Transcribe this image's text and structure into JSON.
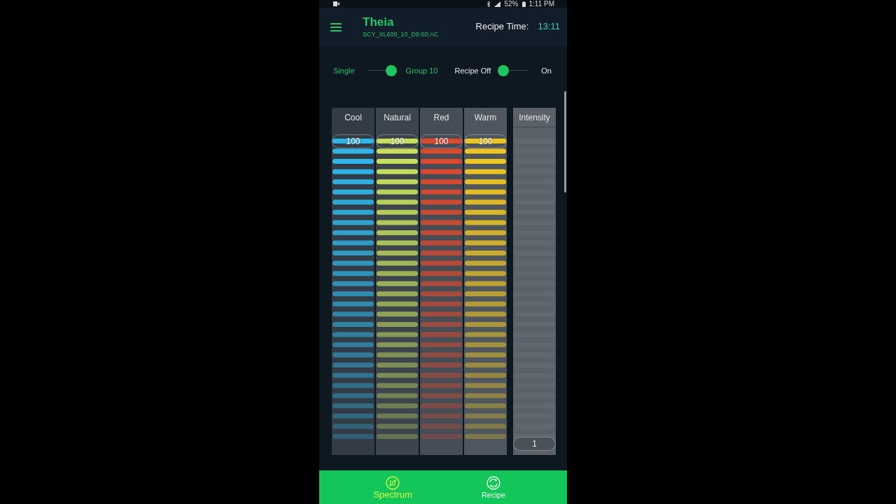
{
  "status_bar": {
    "battery": "52%",
    "time": "1:11 PM"
  },
  "header": {
    "title": "Theia",
    "device_id": "SCY_XL600_10_D9:60:AC",
    "recipe_time_label": "Recipe Time:",
    "recipe_time": "13:11"
  },
  "toggles": [
    {
      "kind": "mode",
      "off_label": "Single",
      "on_label": "Group 10",
      "on": true
    },
    {
      "kind": "recipe",
      "off_label": "Recipe Off",
      "on_label": "On",
      "on": false
    }
  ],
  "channels": [
    {
      "name": "Cool",
      "reading": "100",
      "level": 1,
      "color": "#2db6ea"
    },
    {
      "name": "Natural",
      "reading": "100",
      "level": 1,
      "color": "#c6e05a"
    },
    {
      "name": "Red",
      "reading": "100",
      "level": 1,
      "color": "#e0482c"
    },
    {
      "name": "Warm",
      "reading": "100",
      "level": 1,
      "color": "#f0c51c"
    }
  ],
  "intensity": {
    "name": "Intensity",
    "reading": "1",
    "level": 0.01
  },
  "bottom_nav": [
    {
      "label": "Spectrum",
      "selected": true
    },
    {
      "label": "Recipe",
      "selected": false
    }
  ]
}
